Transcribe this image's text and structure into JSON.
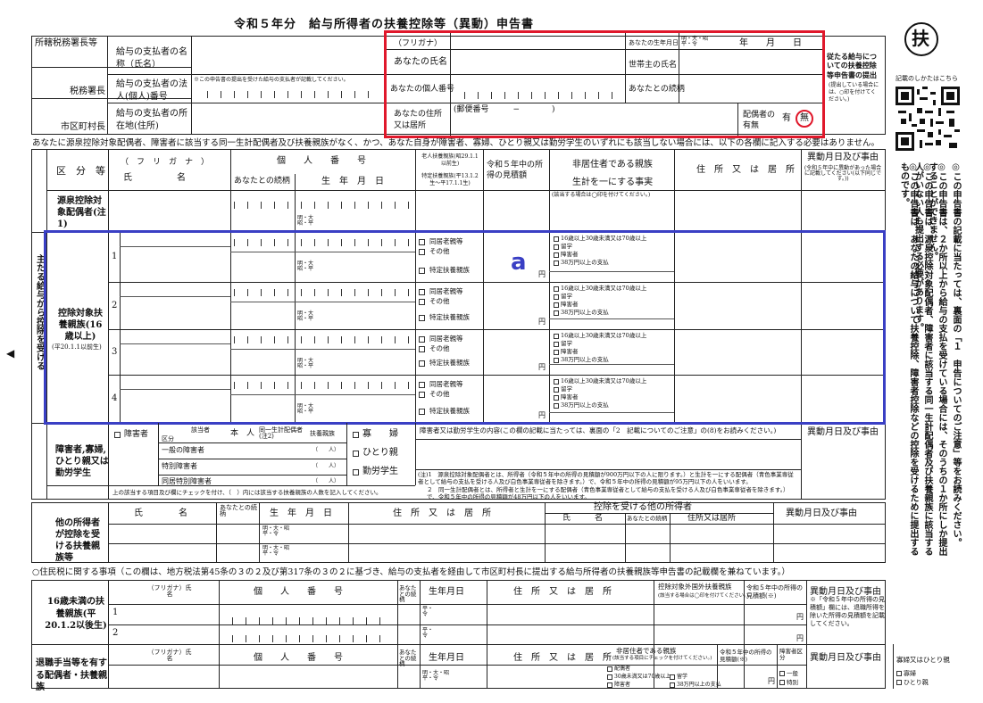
{
  "title": "令和５年分　給与所得者の扶養控除等（異動）申告書",
  "badge": "扶",
  "qr_caption": "記載のしかたはこちら",
  "annotation_label": "a",
  "colors": {
    "red": "#e0182b",
    "blue": "#3a3fc4"
  },
  "header": {
    "tax_office_head": "所轄税務署長等",
    "tax_office": "税務署長",
    "city": "市区町村長",
    "payer_name": "給与の支払者の名称（氏名）",
    "payer_number": "給与の支払者の法人(個人)番号",
    "payer_number_note": "※この申告書の提出を受けた給与の支払者が記載してください。",
    "payer_address": "給与の支払者の所在地(住所)",
    "furigana": "（フリガナ）",
    "your_name": "あなたの氏名",
    "your_number": "あなたの個人番号",
    "your_address": "あなたの住所又は居所",
    "postal": "(郵便番号　　　−　　　　)",
    "birth": "あなたの生年月日",
    "era_box": "明・大・昭平・令",
    "ymd": "年　　月　　日",
    "householder": "世帯主の氏名",
    "relation": "あなたとの続柄",
    "spouse": "配偶者の有無",
    "have": "有",
    "none": "無",
    "side_note": "従たる給与についての扶養控除等申告書の提出",
    "side_note_small": "(提出している場合には、○印を付けてください。)"
  },
  "notice": "あなたに源泉控除対象配偶者、障害者に該当する同一生計配偶者及び扶養親族がなく、かつ、あなた自身が障害者、寡婦、ひとり親又は勤労学生のいずれにも該当しない場合には、以下の各欄に記入する必要はありません。",
  "main_side": "主たる給与から控除を受ける",
  "table": {
    "kubun": "区　分　等",
    "furigana": "（　フ　リ　ガ　ナ　）",
    "shimei": "氏　　　　　名",
    "kojin": "個　　人　　番　　号",
    "zokugara": "あなたとの続柄",
    "birth": "生　年　月　日",
    "elderly": "老人扶養親族(昭29.1.1以前生)",
    "specific": "特定扶養親族(平13.1.2生〜平17.1.1生)",
    "income": "令和５年中の所得の見積額",
    "nonres": "非居住者である親族",
    "same_life": "生計を一にする事実",
    "address": "住　所　又　は　居　所",
    "change": "異動月日及び事由",
    "change_note": "(令和５年中に異動があった場合に記載してください(以下同じです。))",
    "a_label": "源泉控除対象配偶者(注1)",
    "a_note": "(該当する場合は◯印を付けてください。)",
    "b_label": "控除対象扶養親族(16歳以上)",
    "b_sub": "(平20.1.1以前生)",
    "era_opts": "明・大昭・平",
    "yen": "円",
    "opt1": "同居老親等",
    "opt2": "その他",
    "opt3": "特定扶養親族",
    "nr1": "16歳以上30歳未満又は70歳以上",
    "nr2": "留学",
    "nr3": "障害者",
    "nr4": "38万円以上の支払",
    "row_nums": [
      "1",
      "2",
      "3",
      "4"
    ]
  },
  "c": {
    "label": "障害者,寡婦,ひとり親又は勤労学生",
    "handicap": "障害者",
    "kubun": "区分",
    "gaito": "該当者",
    "honnin": "本　人",
    "same": "同一生計配偶者(注2)",
    "fuyou": "扶養親族",
    "general": "一般の障害者",
    "special": "特別障害者",
    "cohab": "同居特別障害者",
    "nin": "（　　人）",
    "widow": "寡　　婦",
    "single": "ひとり親",
    "student": "勤労学生",
    "detail": "障害者又は勤労学生の内容(この欄の記載に当たっては、裏面の「2　記載についてのご注意」の(8)をお読みください。)",
    "bottom_note": "上の該当する項目及び欄にチェックを付け、（　）内には該当する扶養親族の人数を記入してください。",
    "note1": "(注)1　源泉控除対象配偶者とは、所得者（令和５年中の所得の見積額が900万円以下の人に限ります。）と生計を一にする配偶者（青色事業専従者として給与の支払を受ける人及び白色事業専従者を除きます。）で、令和５年中の所得の見積額が95万円以下の人をいいます。",
    "note2": "２　同一生計配偶者とは、所得者と生計を一にする配偶者（青色事業専従者として給与の支払を受ける人及び白色事業専従者を除きます。）で、令和５年中の所得の見積額が48万円以下の人をいいます。"
  },
  "d": {
    "label": "他の所得者が控除を受ける扶養親族等",
    "name": "氏　　　　名",
    "zoku": "あなたとの続柄",
    "birth": "生　年　月　日",
    "address": "住　所　又　は　居　所",
    "other": "控除を受ける他の所得者",
    "o_name": "氏　　　名",
    "o_zoku": "あなたとの続柄",
    "o_address": "住所又は居所",
    "change": "異動月日及び事由",
    "era": "明・大・昭平・令"
  },
  "resident": {
    "title": "○住民税に関する事項（この欄は、地方税法第45条の３の２及び第317条の３の２に基づき、給与の支払者を経由して市区町村長に提出する給与所得者の扶養親族等申告書の記載欄を兼ねています。）",
    "u16": "16歳未満の扶養親族(平20.1.2以後生)",
    "furi": "（フリガナ）氏　　名",
    "kojin": "個　　人　　番　　号",
    "zoku": "あなたとの続柄",
    "birth": "生年月日",
    "address": "住　所　又　は　居　所",
    "overseas": "控除対象外国外扶養親族",
    "overseas_note": "(該当する場合は◯印を付けてください。)",
    "income": "令和５年中の所得の見積額(※)",
    "change": "異動月日及び事由",
    "era": "平・令",
    "retire": "退職手当等を有する配偶者・扶養親族",
    "nonres": "非居住者である親族",
    "nonres_note": "(該当する項目にチェックを付けてください。)",
    "kubun": "障害者区分",
    "opt_spouse": "配偶者",
    "opt_age": "30歳未満又は70歳以上",
    "opt_handi": "障害者",
    "opt_study": "留学",
    "opt_pay": "38万円以上の支払",
    "ippan": "一般",
    "tokubetsu": "特別",
    "widow_single": "寡婦又はひとり親",
    "widow": "寡婦",
    "single": "ひとり親",
    "era2": "明・大・昭平・令",
    "yen": "円",
    "asterisk_note": "※「令和５年中の所得の見積額」欄には、退職所得を除いた所得の見積額を記載してください。"
  },
  "right_notes": {
    "n1": "◎この申告書は、あなたの給与について扶養控除、障害者控除などの控除を受けるために提出するものです。",
    "n2": "◎この申告書は、源泉控除対象配偶者、障害者に該当する同一生計配偶者及び扶養親族に該当する人がいない人も提出する必要があります。",
    "n3": "◎この申告書は、２か所以上から給与の支払を受けている場合には、そのうちの１か所にしか提出することができません。",
    "n4": "◎この申告書の記載に当たっては、裏面の「１　申告についてのご注意」等をお読みください。"
  }
}
